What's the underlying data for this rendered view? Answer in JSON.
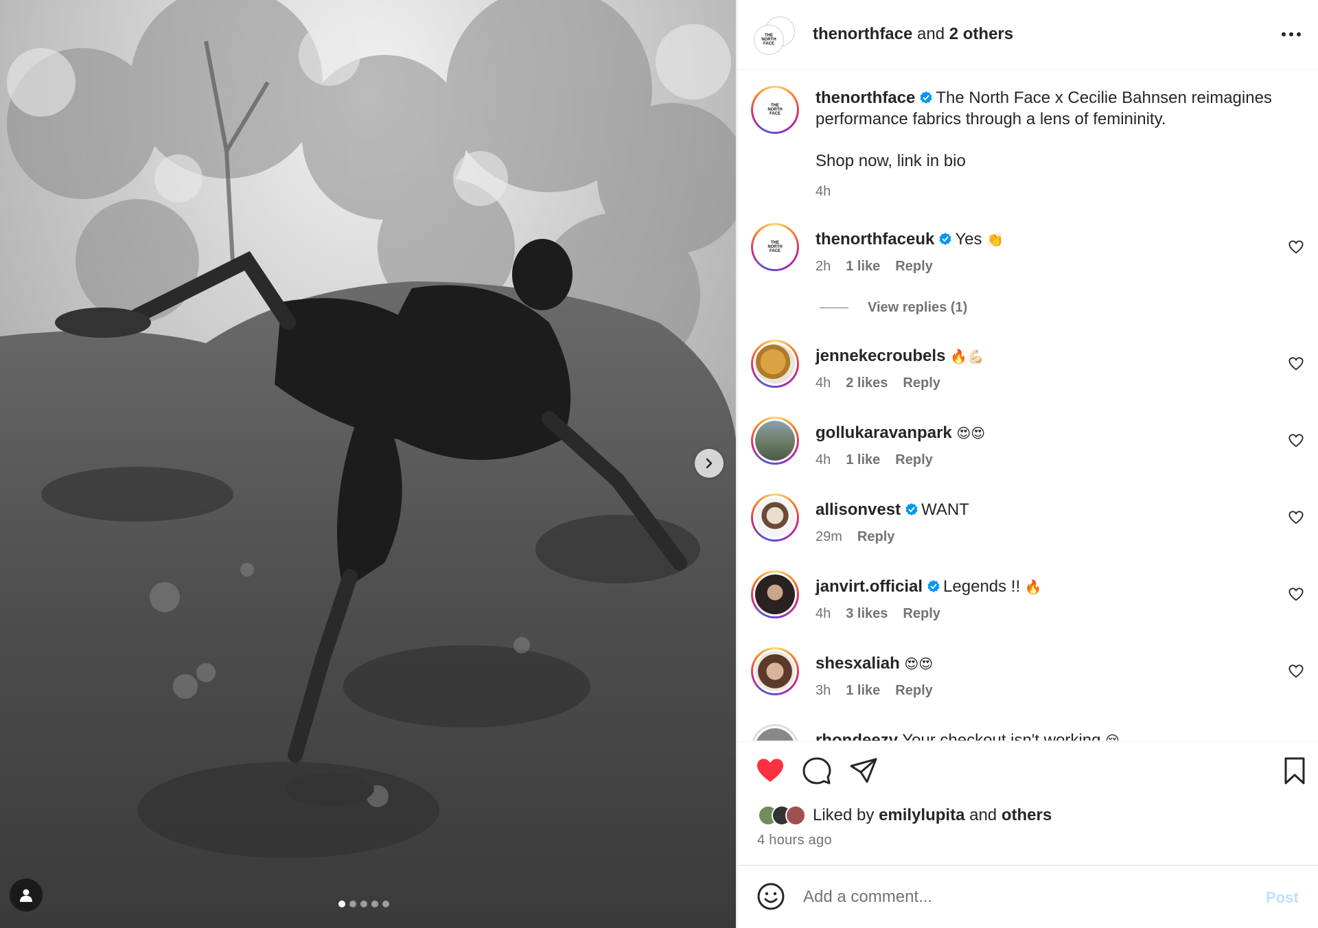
{
  "header": {
    "owner": "thenorthface",
    "connector": "and",
    "others": "2 others",
    "more_icon": "more-horizontal-icon"
  },
  "logo_text": "THE NORTH FACE",
  "caption": {
    "username": "thenorthface",
    "text": "The North Face x Cecilie Bahnsen reimagines performance fabrics through a lens of femininity.",
    "text2": "Shop now, link in bio",
    "time": "4h"
  },
  "comments": [
    {
      "username": "thenorthfaceuk",
      "verified": true,
      "text": "Yes",
      "emoji": "👏",
      "time": "2h",
      "likes": "1 like",
      "reply": "Reply"
    },
    {
      "username": "jennekecroubels",
      "verified": false,
      "text": "",
      "emoji": "🔥💪🏻",
      "time": "4h",
      "likes": "2 likes",
      "reply": "Reply"
    },
    {
      "username": "gollukaravanpark",
      "verified": false,
      "text": "",
      "emoji": "😍😍",
      "time": "4h",
      "likes": "1 like",
      "reply": "Reply"
    },
    {
      "username": "allisonvest",
      "verified": true,
      "text": "WANT",
      "emoji": "",
      "time": "29m",
      "likes": "",
      "reply": "Reply"
    },
    {
      "username": "janvirt.official",
      "verified": true,
      "text": "Legends !!",
      "emoji": "🔥",
      "time": "4h",
      "likes": "3 likes",
      "reply": "Reply"
    },
    {
      "username": "shesxaliah",
      "verified": false,
      "text": "",
      "emoji": "😍😍",
      "time": "3h",
      "likes": "1 like",
      "reply": "Reply"
    },
    {
      "username": "rhondeezy",
      "verified": false,
      "text": "Your checkout isn't working",
      "emoji": "😢",
      "time": "",
      "likes": "",
      "reply": ""
    }
  ],
  "view_replies": "View replies (1)",
  "likes_line": {
    "prefix": "Liked by",
    "user": "emilylupita",
    "and": "and",
    "others": "others"
  },
  "time_ago": "4 hours ago",
  "comment_box": {
    "placeholder": "Add a comment...",
    "post_label": "Post"
  },
  "carousel": {
    "total": 5,
    "active": 0
  },
  "colors": {
    "like_red": "#ff3040",
    "verified_blue": "#0095f6",
    "post_disabled": "#c0dffd",
    "muted_text": "#737373"
  }
}
